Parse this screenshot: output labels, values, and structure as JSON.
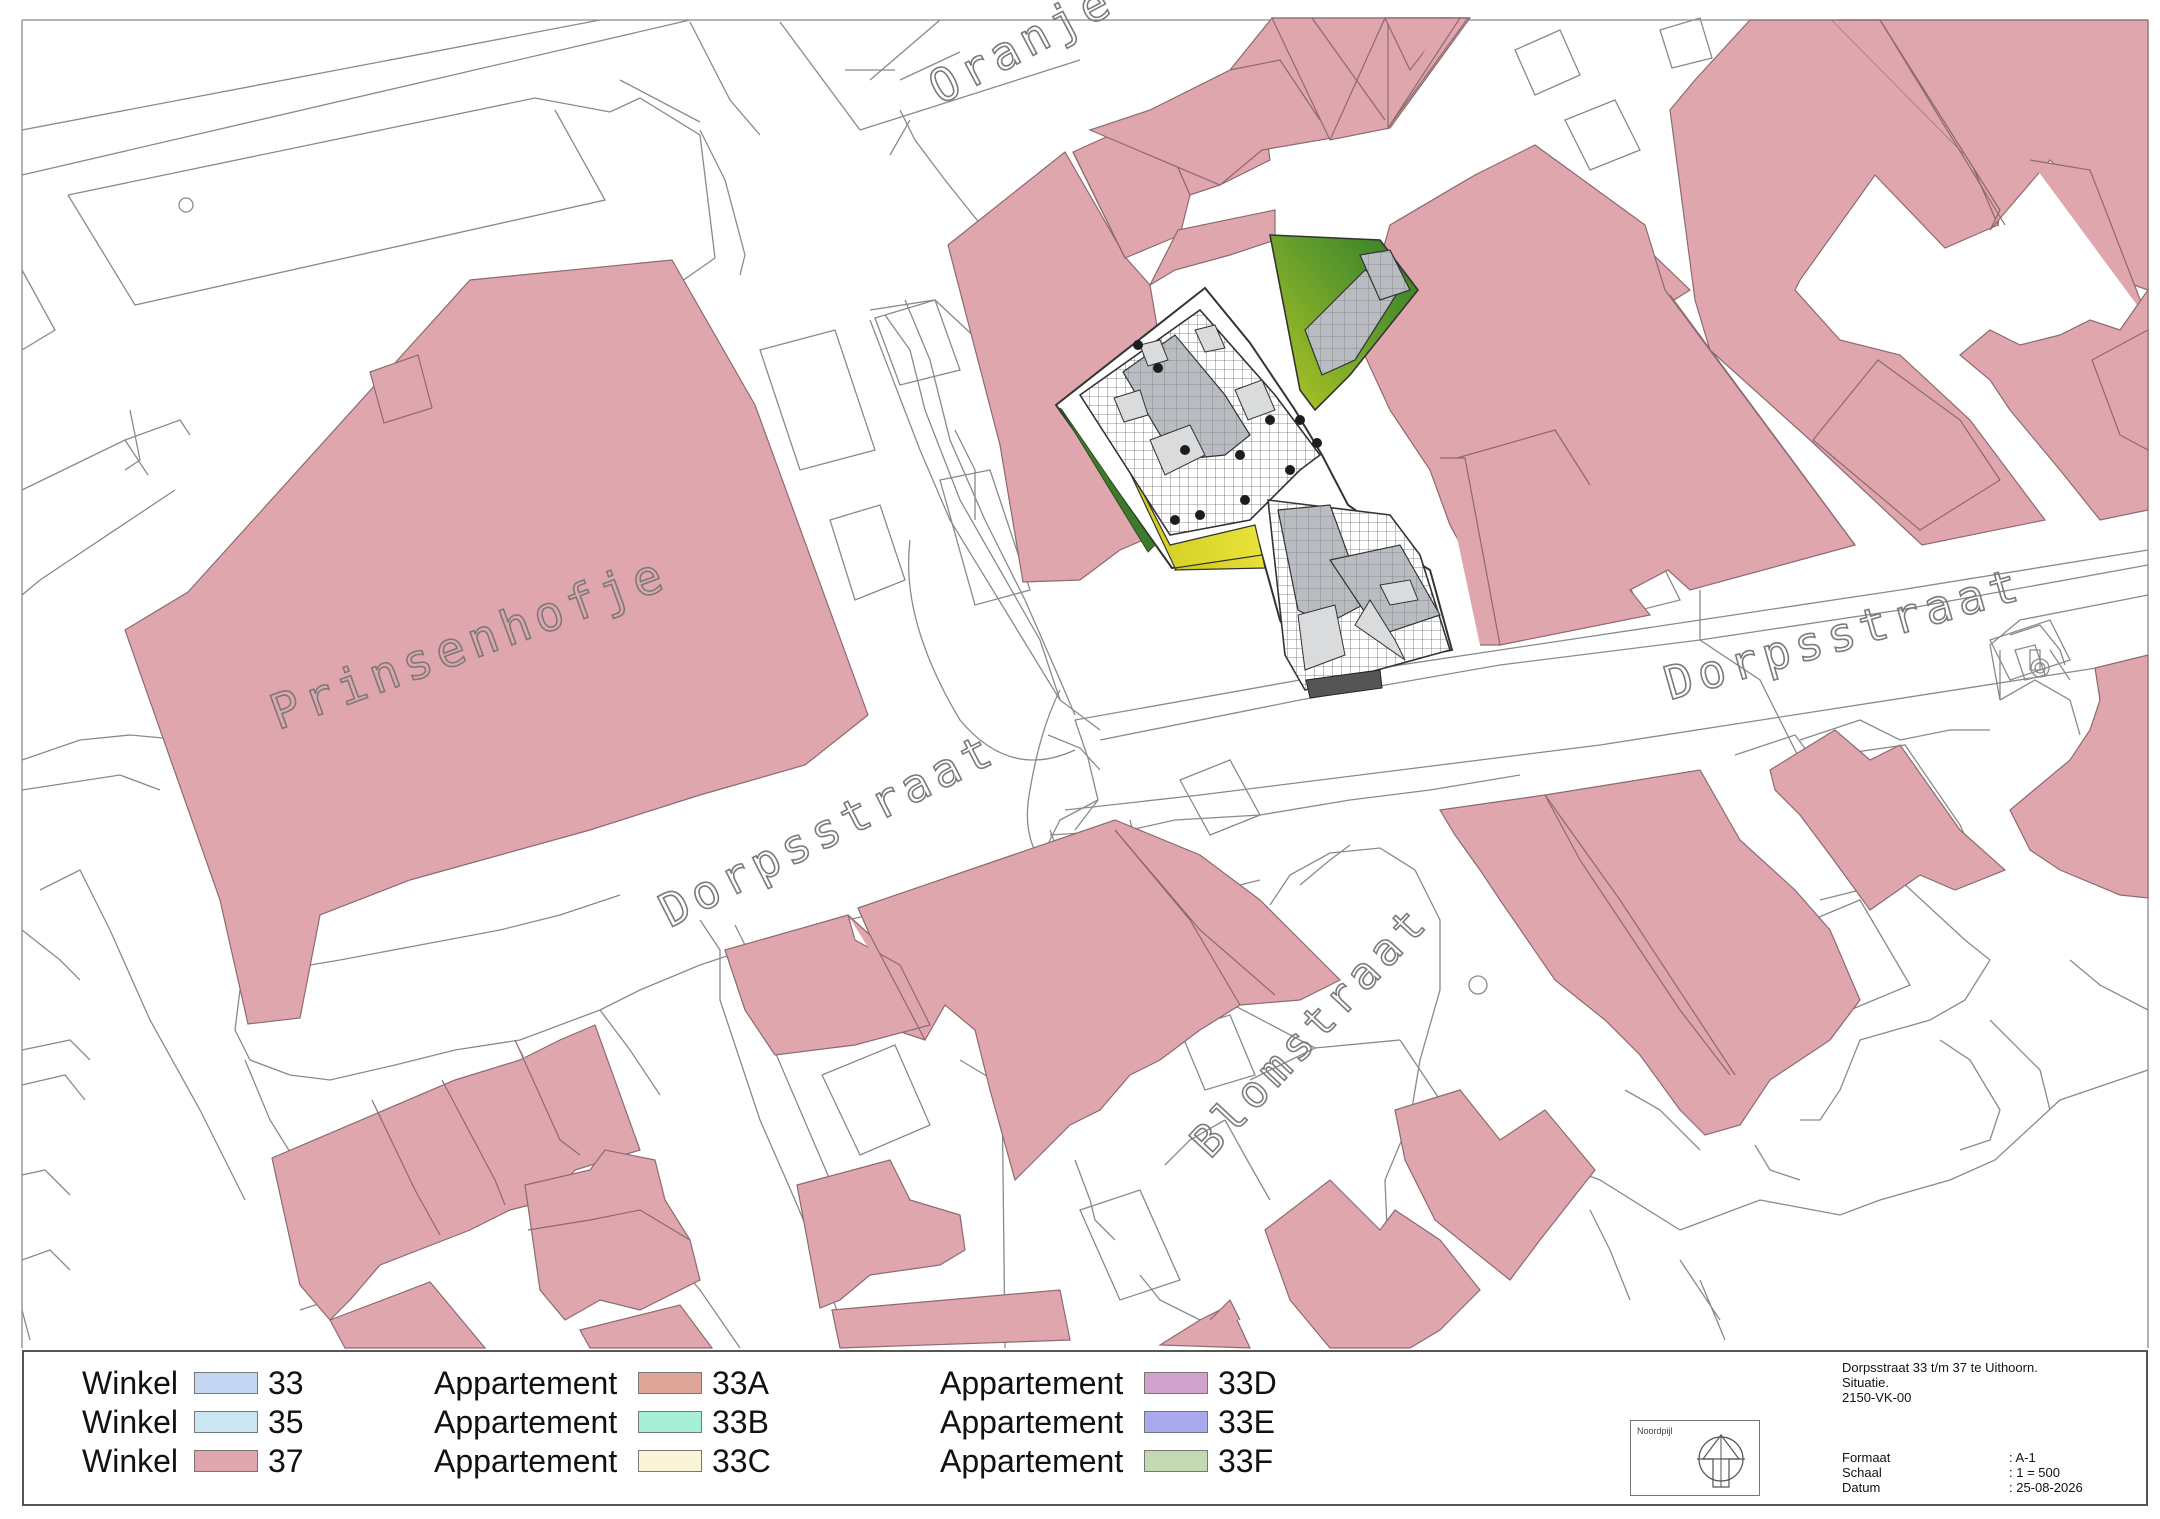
{
  "map": {
    "building_color": "#e0a6ad",
    "building_stroke": "#8c6a70",
    "line_color": "#8a8a8a",
    "street_labels": {
      "oranjelaan": "Oranje",
      "prinsenhofje": "Prinsenhofje",
      "dorpsstraat_west": "Dorpsstraat",
      "dorpsstraat_east": "Dorpsstraat",
      "blomstraat": "Blomstraat"
    }
  },
  "legend": {
    "columns": [
      [
        {
          "label": "Winkel",
          "code": "33",
          "color": "#c5d6f2"
        },
        {
          "label": "Winkel",
          "code": "35",
          "color": "#c9e6f2"
        },
        {
          "label": "Winkel",
          "code": "37",
          "color": "#e0a6ad"
        }
      ],
      [
        {
          "label": "Appartement",
          "code": "33A",
          "color": "#dfa596"
        },
        {
          "label": "Appartement",
          "code": "33B",
          "color": "#a6f0d6"
        },
        {
          "label": "Appartement",
          "code": "33C",
          "color": "#fbf5d7"
        }
      ],
      [
        {
          "label": "Appartement",
          "code": "33D",
          "color": "#cfa3cc"
        },
        {
          "label": "Appartement",
          "code": "33E",
          "color": "#a9a9ee"
        },
        {
          "label": "Appartement",
          "code": "33F",
          "color": "#c3d9b1"
        }
      ]
    ]
  },
  "title_block": {
    "project": "Dorpsstraat 33 t/m 37 te Uithoorn.",
    "subject": "Situatie.",
    "drawing_no": "2150-VK-00",
    "north_label": "Noordpijl",
    "fields": [
      {
        "key": "Formaat",
        "value": ": A-1"
      },
      {
        "key": "Schaal",
        "value": ": 1 = 500"
      },
      {
        "key": "Datum",
        "value": ": 25-08-2026"
      }
    ]
  }
}
